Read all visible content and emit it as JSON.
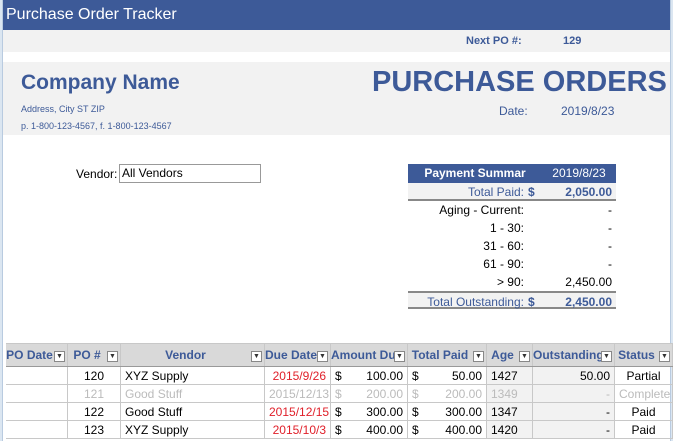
{
  "app": {
    "title": "Purchase Order Tracker"
  },
  "next_po": {
    "label": "Next PO #:",
    "value": "129"
  },
  "company": {
    "name": "Company Name",
    "address": "Address, City ST ZIP",
    "phone": "p. 1-800-123-4567, f. 1-800-123-4567"
  },
  "doc": {
    "title": "PURCHASE ORDERS",
    "date_label": "Date:",
    "date": "2019/8/23"
  },
  "vendor_filter": {
    "label": "Vendor:",
    "value": "All Vendors"
  },
  "summary": {
    "title": "Payment Summar",
    "date": "2019/8/23",
    "total_paid_label": "Total Paid:",
    "currency": "$",
    "total_paid": "2,050.00",
    "aging": [
      {
        "label": "Aging - Current:",
        "value": "-"
      },
      {
        "label": "1 - 30:",
        "value": "-"
      },
      {
        "label": "31 - 60:",
        "value": "-"
      },
      {
        "label": "61 - 90:",
        "value": "-"
      },
      {
        "label": "> 90:",
        "value": "2,450.00"
      }
    ],
    "total_outstanding_label": "Total Outstanding:",
    "total_outstanding": "2,450.00"
  },
  "table": {
    "columns": [
      "PO Date",
      "PO #",
      "Vendor",
      "Due Date",
      "Amount Due",
      "Total Paid",
      "Age",
      "Outstanding",
      "Status"
    ],
    "rows": [
      {
        "po_date": "",
        "po": "120",
        "vendor": "XYZ Supply",
        "due": "2015/9/26",
        "amount": "100.00",
        "paid": "50.00",
        "age": "1427",
        "outstanding": "50.00",
        "status": "Partial",
        "faded": false
      },
      {
        "po_date": "",
        "po": "121",
        "vendor": "Good Stuff",
        "due": "2015/12/13",
        "amount": "200.00",
        "paid": "200.00",
        "age": "1349",
        "outstanding": "-",
        "status": "Complete",
        "faded": true
      },
      {
        "po_date": "",
        "po": "122",
        "vendor": "Good Stuff",
        "due": "2015/12/15",
        "amount": "300.00",
        "paid": "300.00",
        "age": "1347",
        "outstanding": "-",
        "status": "Paid",
        "faded": false
      },
      {
        "po_date": "",
        "po": "123",
        "vendor": "XYZ Supply",
        "due": "2015/10/3",
        "amount": "400.00",
        "paid": "400.00",
        "age": "1420",
        "outstanding": "-",
        "status": "Paid",
        "faded": false
      }
    ]
  },
  "colors": {
    "accent": "#3d5a98",
    "overdue": "#e0202a",
    "band": "#f2f2f2"
  }
}
